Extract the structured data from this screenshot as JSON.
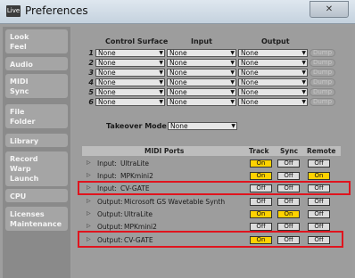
{
  "window": {
    "title": "Preferences",
    "app_icon_text": "Live",
    "close_glyph": "✕"
  },
  "sidebar": {
    "tabs": [
      {
        "lines": [
          "Look",
          "Feel"
        ]
      },
      {
        "lines": [
          "Audio"
        ]
      },
      {
        "lines": [
          "MIDI",
          "Sync"
        ]
      },
      {
        "lines": [
          "File",
          "Folder"
        ]
      },
      {
        "lines": [
          "Library"
        ]
      },
      {
        "lines": [
          "Record",
          "Warp",
          "Launch"
        ]
      },
      {
        "lines": [
          "CPU"
        ]
      },
      {
        "lines": [
          "Licenses",
          "Maintenance"
        ]
      }
    ]
  },
  "control_surfaces": {
    "headers": {
      "surface": "Control Surface",
      "input": "Input",
      "output": "Output"
    },
    "rows": [
      {
        "num": "1",
        "surface": "None",
        "input": "None",
        "output": "None",
        "dump": "Dump"
      },
      {
        "num": "2",
        "surface": "None",
        "input": "None",
        "output": "None",
        "dump": "Dump"
      },
      {
        "num": "3",
        "surface": "None",
        "input": "None",
        "output": "None",
        "dump": "Dump"
      },
      {
        "num": "4",
        "surface": "None",
        "input": "None",
        "output": "None",
        "dump": "Dump"
      },
      {
        "num": "5",
        "surface": "None",
        "input": "None",
        "output": "None",
        "dump": "Dump"
      },
      {
        "num": "6",
        "surface": "None",
        "input": "None",
        "output": "None",
        "dump": "Dump"
      }
    ]
  },
  "takeover": {
    "label": "Takeover Mode",
    "value": "None"
  },
  "midi_ports": {
    "headers": {
      "ports": "MIDI Ports",
      "track": "Track",
      "sync": "Sync",
      "remote": "Remote"
    },
    "rows": [
      {
        "dir": "Input:",
        "name": "UltraLite",
        "track": "On",
        "sync": "Off",
        "remote": "Off"
      },
      {
        "dir": "Input:",
        "name": "MPKmini2",
        "track": "On",
        "sync": "Off",
        "remote": "On"
      },
      {
        "dir": "Input:",
        "name": "CV-GATE",
        "track": "Off",
        "sync": "Off",
        "remote": "Off"
      },
      {
        "dir": "Output:",
        "name": "Microsoft GS Wavetable Synth",
        "track": "Off",
        "sync": "Off",
        "remote": "Off"
      },
      {
        "dir": "Output:",
        "name": "UltraLite",
        "track": "On",
        "sync": "On",
        "remote": "Off"
      },
      {
        "dir": "Output:",
        "name": "MPKmini2",
        "track": "Off",
        "sync": "Off",
        "remote": "Off"
      },
      {
        "dir": "Output:",
        "name": "CV-GATE",
        "track": "On",
        "sync": "Off",
        "remote": "Off"
      }
    ]
  },
  "colors": {
    "on": "#ffd200",
    "off": "#dcdcdc",
    "highlight": "#e0141e"
  }
}
